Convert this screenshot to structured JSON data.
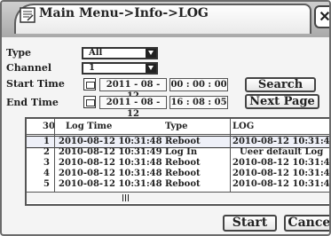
{
  "window": {
    "title": "Main Menu->Info->LOG",
    "close_glyph": "✕",
    "app_icon": "log-app-icon"
  },
  "filters": {
    "type_label": "Type",
    "type_value": "All",
    "channel_label": "Channel",
    "channel_value": "1",
    "start_label": "Start Time",
    "start_date": "2011 - 08 - 12",
    "start_time": "00 : 00 : 00",
    "end_label": "End Time",
    "end_date": "2011 - 08 - 12",
    "end_time": "16 : 08 : 05"
  },
  "buttons": {
    "search": "Search",
    "next_page": "Next Page",
    "start": "Start",
    "cancel": "Cancel"
  },
  "table": {
    "count": "30",
    "headers": [
      "Log Time",
      "Type",
      "LOG"
    ],
    "rows": [
      {
        "no": "1",
        "time": "2010-08-12 10:31:48",
        "type": "Reboot",
        "log": "2010-08-12 10:31:48"
      },
      {
        "no": "2",
        "time": "2010-08-12 10:31:49",
        "type": "Log In",
        "log": "Ueer default Log"
      },
      {
        "no": "3",
        "time": "2010-08-12 10:31:48",
        "type": "Reboot",
        "log": "2010-08-12 10:31:48"
      },
      {
        "no": "4",
        "time": "2010-08-12 10:31:48",
        "type": "Reboot",
        "log": "2010-08-12 10:31:48"
      },
      {
        "no": "5",
        "time": "2010-08-12 10:31:48",
        "type": "Reboot",
        "log": "2010-08-12 10:31:48"
      }
    ]
  }
}
